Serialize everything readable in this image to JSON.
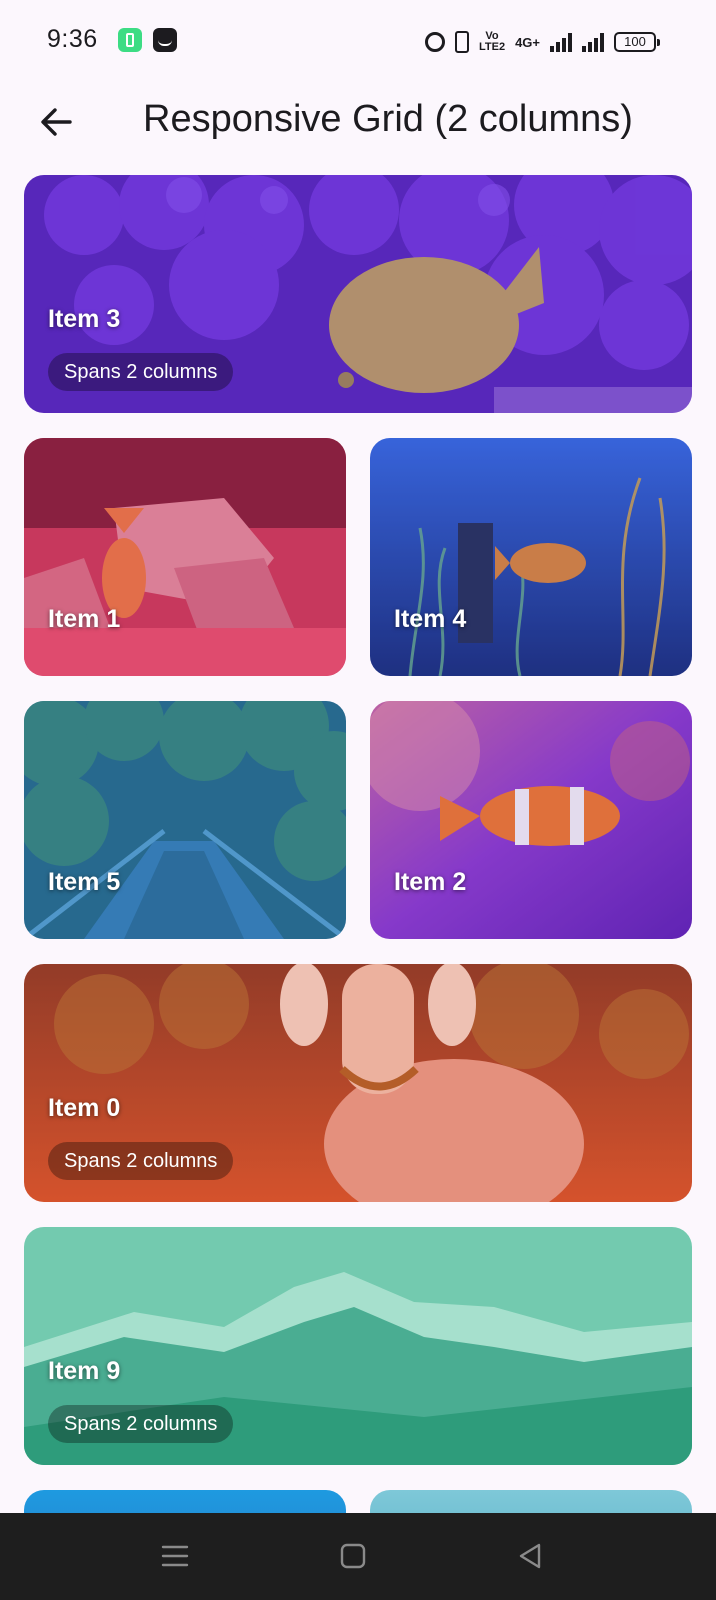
{
  "status_bar": {
    "time": "9:36",
    "volte_top": "Vo",
    "volte_bottom": "LTE2",
    "network": "4G+",
    "battery": "100"
  },
  "app_bar": {
    "title": "Responsive Grid (2 columns)",
    "back_icon": "arrow-back-icon"
  },
  "tiles": [
    {
      "label": "Item 3",
      "badge": "Spans 2 columns",
      "scene": "coral-reef-yellow-tang",
      "tint": "#6a33c9"
    },
    {
      "label": "Item 1",
      "badge": "",
      "scene": "fox-on-rocks",
      "tint": "#e03763"
    },
    {
      "label": "Item 4",
      "badge": "",
      "scene": "aquarium-orange-fish",
      "tint": "#2e44a8"
    },
    {
      "label": "Item 5",
      "badge": "",
      "scene": "forest-bridge",
      "tint": "#1f6fa6"
    },
    {
      "label": "Item 2",
      "badge": "",
      "scene": "clownfish",
      "tint": "#6a2bbf"
    },
    {
      "label": "Item 0",
      "badge": "Spans 2 columns",
      "scene": "goat-in-field",
      "tint": "#d84a22"
    },
    {
      "label": "Item 9",
      "badge": "Spans 2 columns",
      "scene": "mountain-range",
      "tint": "#2fb08a"
    }
  ],
  "nav_bar": {
    "icons": [
      "menu-icon",
      "home-icon",
      "back-triangle-icon"
    ]
  }
}
